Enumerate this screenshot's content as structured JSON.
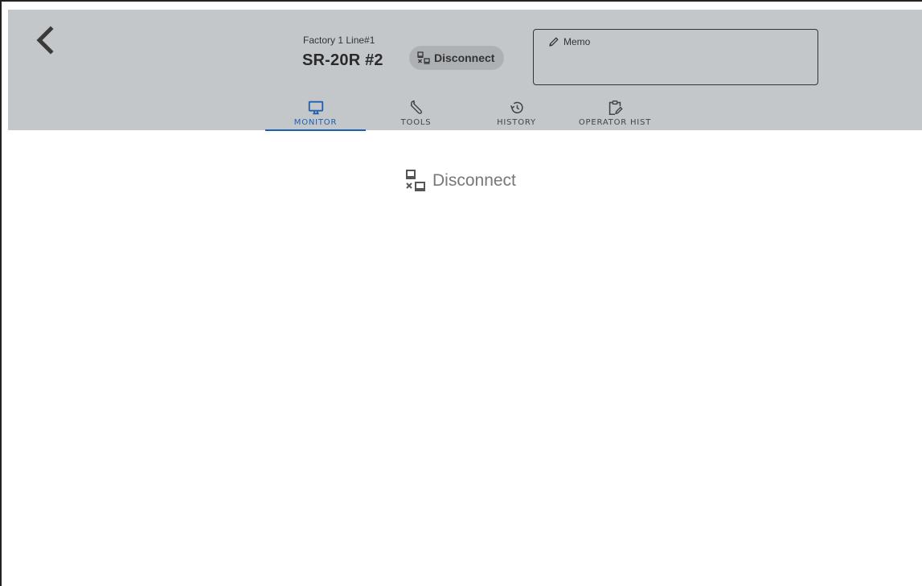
{
  "header": {
    "subtitle": "Factory 1 Line#1",
    "title": "SR-20R #2",
    "status_chip": {
      "label": "Disconnect",
      "icon": "disconnect-icon"
    },
    "memo": {
      "label": "Memo",
      "icon": "pencil-icon",
      "value": ""
    },
    "back_icon": "chevron-left-icon"
  },
  "tabs": [
    {
      "label": "MONITOR",
      "icon": "monitor-icon",
      "active": true
    },
    {
      "label": "TOOLS",
      "icon": "wrench-icon",
      "active": false
    },
    {
      "label": "HISTORY",
      "icon": "history-icon",
      "active": false
    },
    {
      "label": "OPERATOR HIST",
      "icon": "clipboard-edit-icon",
      "active": false
    }
  ],
  "main": {
    "status_label": "Disconnect",
    "status_icon": "disconnect-icon"
  },
  "colors": {
    "header_bg": "#c4c7ca",
    "accent": "#1f5fb0",
    "chip_bg": "#aeb1b4"
  }
}
